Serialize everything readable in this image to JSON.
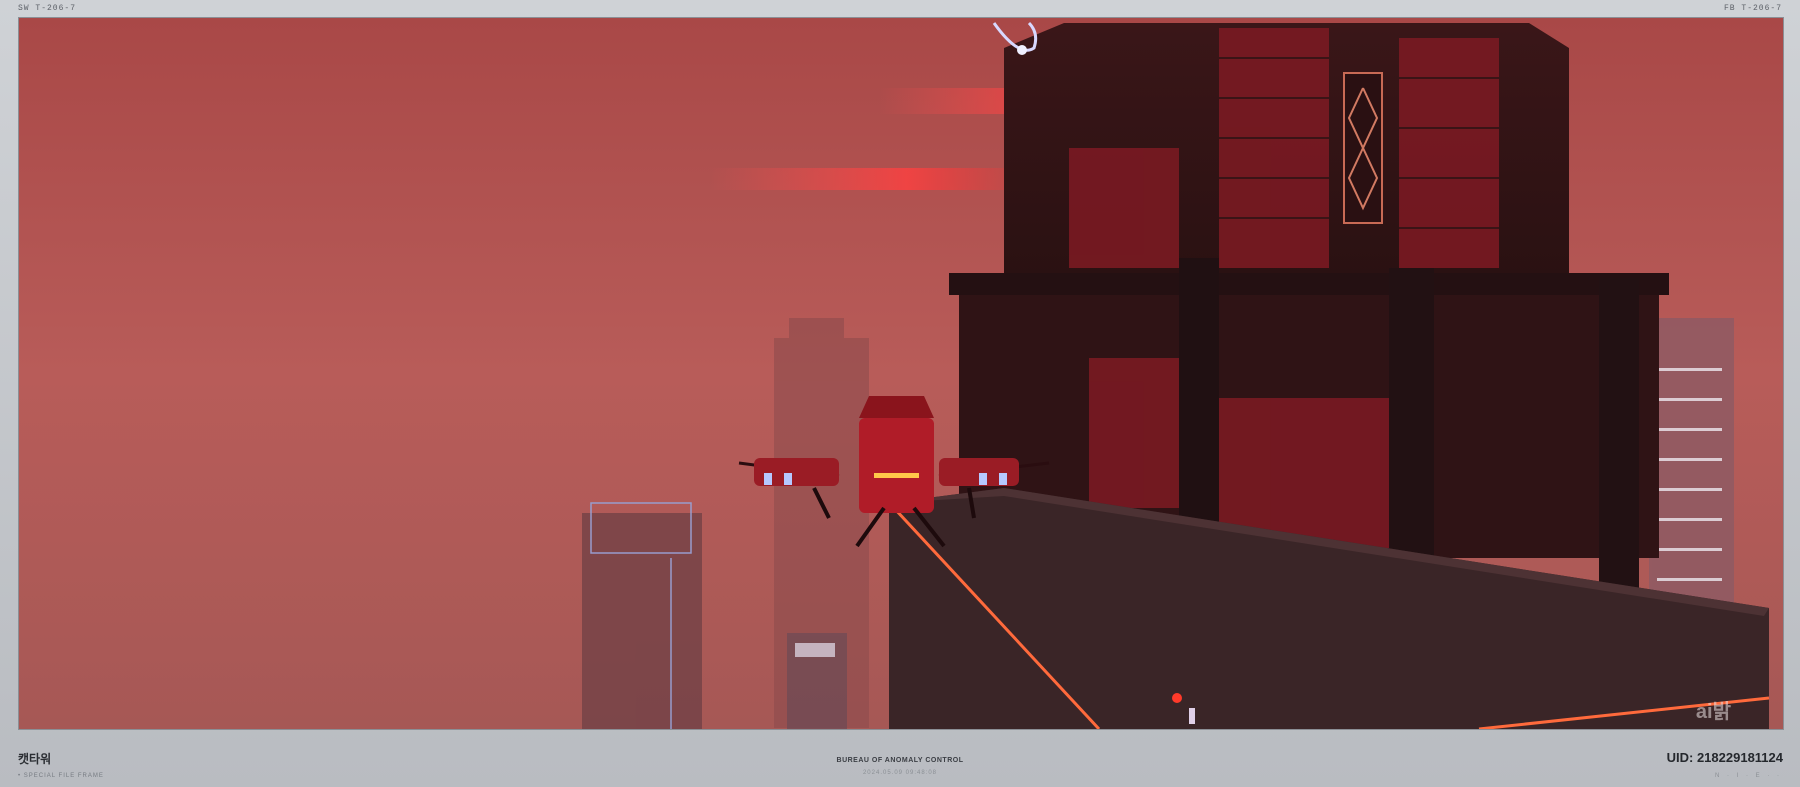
{
  "header": {
    "left_tag": "SW  T-206-7",
    "right_tag": "FB  T-206-7"
  },
  "footer": {
    "location_name": "캣타워",
    "sub_label": "• SPECIAL FILE FRAME",
    "center_title": "BUREAU OF ANOMALY CONTROL",
    "center_date": "2024.05.09 09:48:08",
    "uid_label": "UID: 218229181124",
    "right_marks": "N · I · E · ·"
  },
  "scene": {
    "watermark": "ai밝",
    "colors": {
      "sky": "#b2605c",
      "tower": "#3a1a1c",
      "neon": "#ff5a3c",
      "drone": "#b01c28"
    }
  }
}
